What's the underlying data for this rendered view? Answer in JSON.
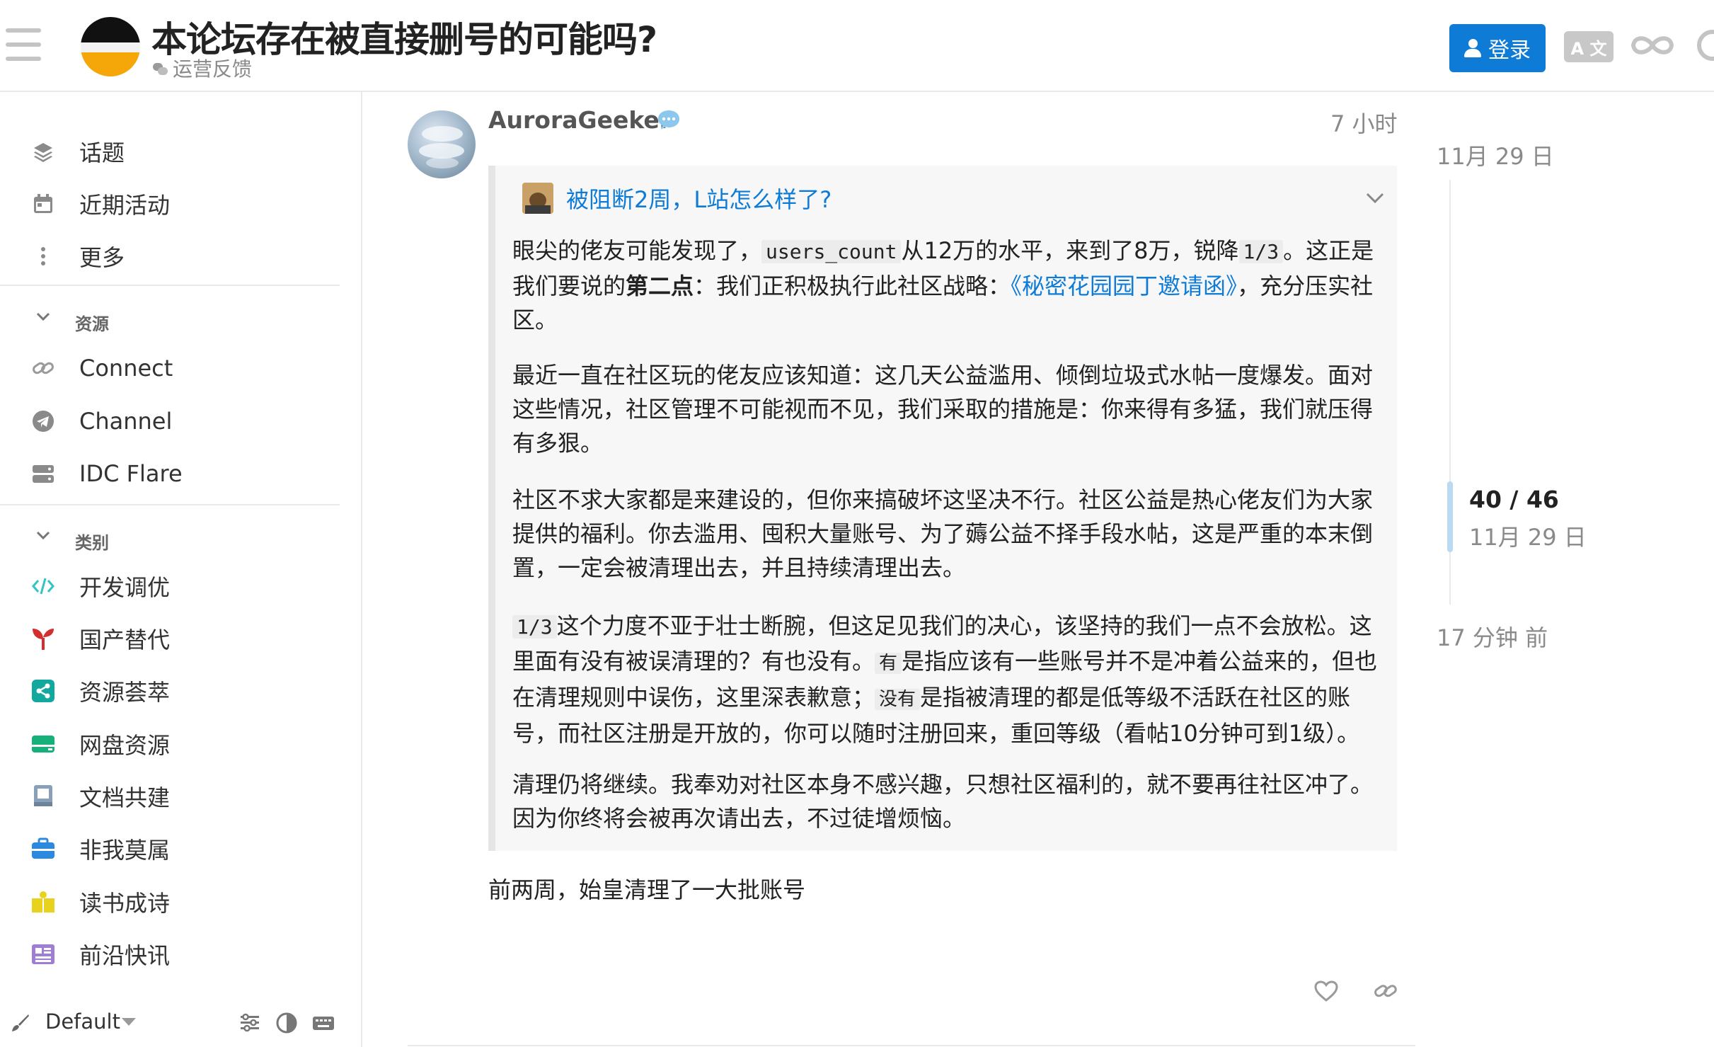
{
  "header": {
    "title": "本论坛存在被直接删号的可能吗?",
    "category": "运营反馈",
    "login_label": "登录",
    "translate_label": "A 文"
  },
  "sidebar": {
    "items": [
      {
        "label": "话题",
        "icon": "layers-icon"
      },
      {
        "label": "近期活动",
        "icon": "calendar-icon"
      },
      {
        "label": "更多",
        "icon": "more-vertical-icon"
      }
    ],
    "resources_header": "资源",
    "resources": [
      {
        "label": "Connect",
        "icon": "link-icon"
      },
      {
        "label": "Channel",
        "icon": "telegram-icon"
      },
      {
        "label": "IDC Flare",
        "icon": "server-icon"
      }
    ],
    "categories_header": "类别",
    "categories": [
      {
        "label": "开发调优",
        "icon": "code-icon",
        "color": "#32c3c3"
      },
      {
        "label": "国产替代",
        "icon": "sprout-icon",
        "color": "#d32f2f"
      },
      {
        "label": "资源荟萃",
        "icon": "share-icon",
        "color": "#12a89d"
      },
      {
        "label": "网盘资源",
        "icon": "drive-icon",
        "color": "#16b07a"
      },
      {
        "label": "文档共建",
        "icon": "book-icon",
        "color": "#8aa0ba"
      },
      {
        "label": "非我莫属",
        "icon": "briefcase-icon",
        "color": "#2b8ae0"
      },
      {
        "label": "读书成诗",
        "icon": "reading-icon",
        "color": "#e8d21d"
      },
      {
        "label": "前沿快讯",
        "icon": "newspaper-icon",
        "color": "#a07ed6"
      }
    ],
    "footer": {
      "theme_label": "Default"
    }
  },
  "post": {
    "username": "AuroraGeeker",
    "age": "7 小时",
    "quote": {
      "title": "被阻断2周，L站怎么样了?",
      "p1": {
        "a": "眼尖的佬友可能发现了，",
        "code1": "users_count",
        "b": "从12万的水平，来到了8万，锐降",
        "code2": "1/3",
        "c": "。这正是我们要说的",
        "strong": "第二点",
        "d": "：我们正积极执行此社区战略：",
        "link": "《秘密花园园丁邀请函》",
        "e": "，充分压实社区。"
      },
      "p2": "最近一直在社区玩的佬友应该知道：这几天公益滥用、倾倒垃圾式水帖一度爆发。面对这些情况，社区管理不可能视而不见，我们采取的措施是：你来得有多猛，我们就压得有多狠。",
      "p3": "社区不求大家都是来建设的，但你来搞破坏这坚决不行。社区公益是热心佬友们为大家提供的福利。你去滥用、囤积大量账号、为了薅公益不择手段水帖，这是严重的本末倒置，一定会被清理出去，并且持续清理出去。",
      "p4": {
        "code1": "1/3",
        "a": "这个力度不亚于壮士断腕，但这足见我们的决心，该坚持的我们一点不会放松。这里面有没有被误清理的？有也没有。",
        "code2": "有",
        "b": "是指应该有一些账号并不是冲着公益来的，但也在清理规则中误伤，这里深表歉意；",
        "code3": "没有",
        "c": "是指被清理的都是低等级不活跃在社区的账号，而社区注册是开放的，你可以随时注册回来，重回等级（看帖10分钟可到1级）。"
      },
      "p5": "清理仍将继续。我奉劝对社区本身不感兴趣，只想社区福利的，就不要再往社区冲了。因为你终将会被再次请出去，不过徒增烦恼。"
    },
    "body": "前两周，始皇清理了一大批账号"
  },
  "timeline": {
    "start_date": "11月 29 日",
    "position": "40 / 46",
    "position_date": "11月 29 日",
    "end_label": "17 分钟 前"
  },
  "colors": {
    "accent": "#0e7bd6",
    "quote_bg": "#f7f7f7",
    "timeline_handle": "#b9daf2"
  }
}
